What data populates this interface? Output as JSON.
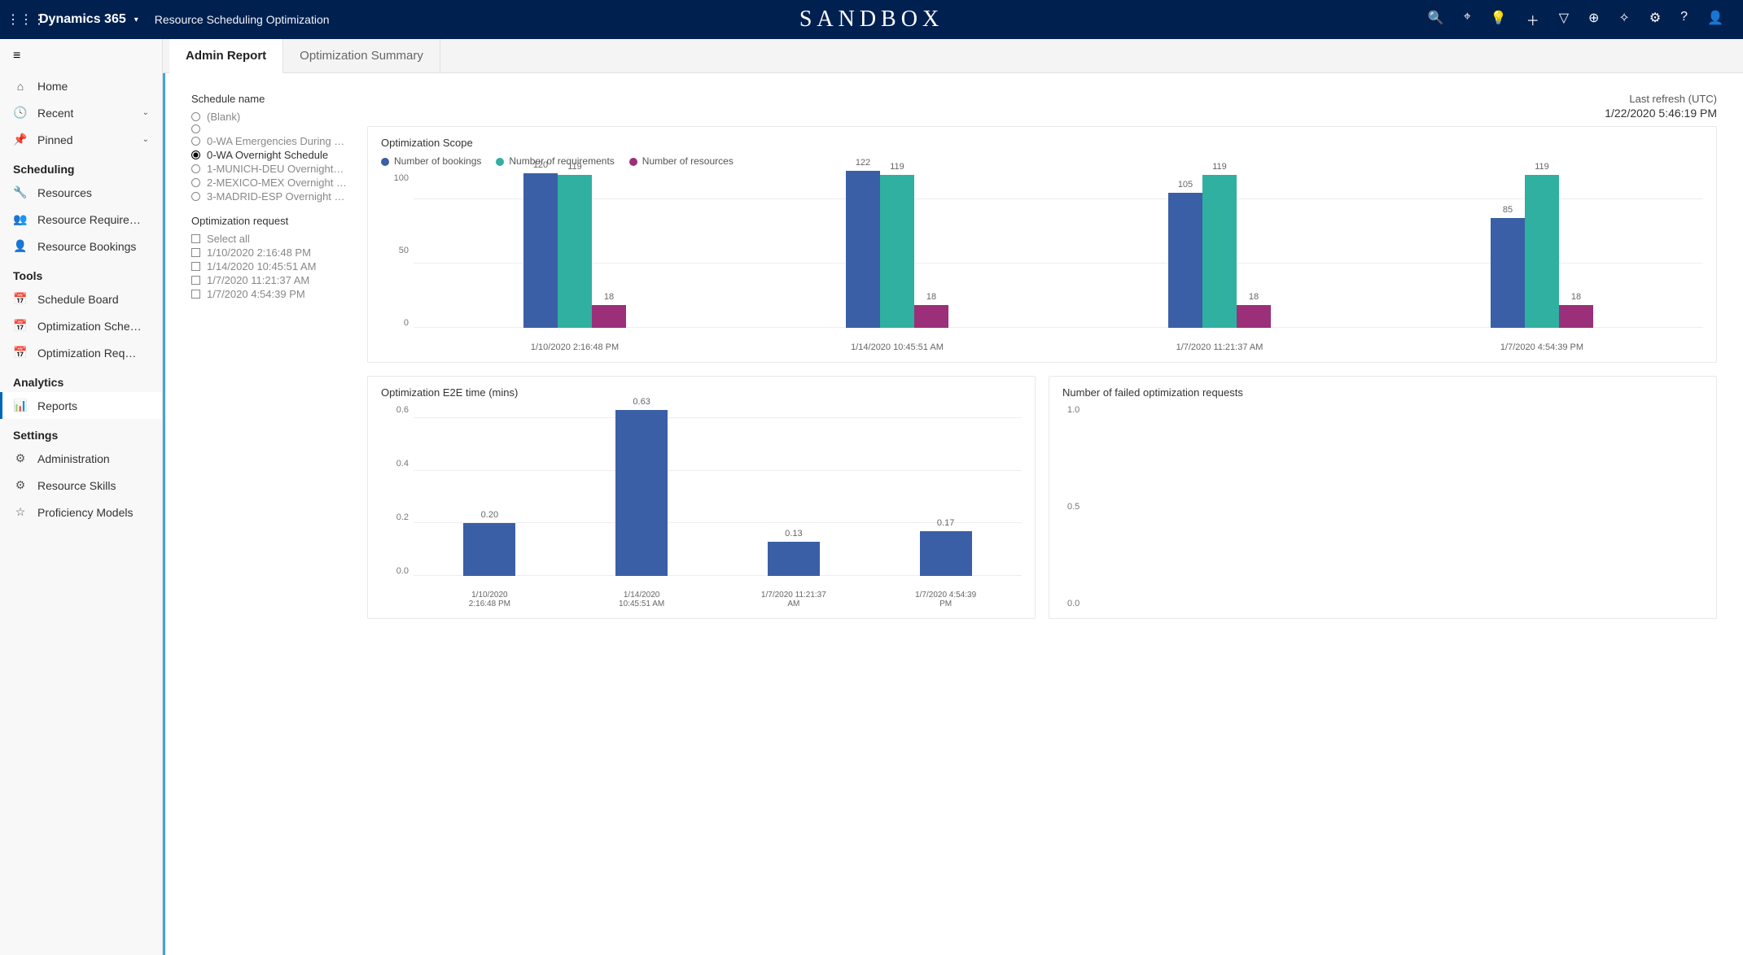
{
  "header": {
    "brand": "Dynamics 365",
    "subtitle": "Resource Scheduling Optimization",
    "envBadge": "SANDBOX"
  },
  "sidebar": {
    "top": [
      {
        "icon": "⌂",
        "label": "Home",
        "expandable": false
      },
      {
        "icon": "🕓",
        "label": "Recent",
        "expandable": true
      },
      {
        "icon": "📌",
        "label": "Pinned",
        "expandable": true
      }
    ],
    "groups": [
      {
        "title": "Scheduling",
        "items": [
          {
            "icon": "🔧",
            "label": "Resources"
          },
          {
            "icon": "👥",
            "label": "Resource Require…"
          },
          {
            "icon": "👤",
            "label": "Resource Bookings"
          }
        ]
      },
      {
        "title": "Tools",
        "items": [
          {
            "icon": "📅",
            "label": "Schedule Board"
          },
          {
            "icon": "📅",
            "label": "Optimization Sche…"
          },
          {
            "icon": "📅",
            "label": "Optimization Req…"
          }
        ]
      },
      {
        "title": "Analytics",
        "items": [
          {
            "icon": "📊",
            "label": "Reports",
            "active": true
          }
        ]
      },
      {
        "title": "Settings",
        "items": [
          {
            "icon": "⚙",
            "label": "Administration"
          },
          {
            "icon": "⚙",
            "label": "Resource Skills"
          },
          {
            "icon": "☆",
            "label": "Proficiency Models"
          }
        ]
      }
    ]
  },
  "tabs": [
    {
      "label": "Admin Report",
      "active": true
    },
    {
      "label": "Optimization Summary",
      "active": false
    }
  ],
  "refresh": {
    "label": "Last refresh (UTC)",
    "timestamp": "1/22/2020 5:46:19 PM"
  },
  "filters": {
    "schedule": {
      "title": "Schedule name",
      "options": [
        {
          "label": "(Blank)"
        },
        {
          "label": ""
        },
        {
          "label": "0-WA Emergencies During …"
        },
        {
          "label": "0-WA Overnight Schedule",
          "selected": true
        },
        {
          "label": "1-MUNICH-DEU Overnight…"
        },
        {
          "label": "2-MEXICO-MEX Overnight …"
        },
        {
          "label": "3-MADRID-ESP Overnight …"
        }
      ]
    },
    "request": {
      "title": "Optimization request",
      "options": [
        {
          "label": "Select all"
        },
        {
          "label": "1/10/2020 2:16:48 PM"
        },
        {
          "label": "1/14/2020 10:45:51 AM"
        },
        {
          "label": "1/7/2020 11:21:37 AM"
        },
        {
          "label": "1/7/2020 4:54:39 PM"
        }
      ]
    }
  },
  "chart_data": [
    {
      "type": "bar",
      "title": "Optimization Scope",
      "legend": [
        "Number of bookings",
        "Number of requirements",
        "Number of resources"
      ],
      "categories": [
        "1/10/2020 2:16:48 PM",
        "1/14/2020 10:45:51 AM",
        "1/7/2020 11:21:37 AM",
        "1/7/2020 4:54:39 PM"
      ],
      "series": [
        {
          "name": "Number of bookings",
          "values": [
            120,
            122,
            105,
            85
          ],
          "color": "#3b5fa6"
        },
        {
          "name": "Number of requirements",
          "values": [
            119,
            119,
            119,
            119
          ],
          "color": "#2fb0a0"
        },
        {
          "name": "Number of resources",
          "values": [
            18,
            18,
            18,
            18
          ],
          "color": "#9b2f7a"
        }
      ],
      "ymax": 120,
      "yticks": [
        0,
        50,
        100
      ]
    },
    {
      "type": "bar",
      "title": "Optimization E2E time (mins)",
      "categories": [
        "1/10/2020 2:16:48 PM",
        "1/14/2020 10:45:51 AM",
        "1/7/2020 11:21:37 AM",
        "1/7/2020 4:54:39 PM"
      ],
      "values": [
        0.2,
        0.63,
        0.13,
        0.17
      ],
      "ymax": 0.65,
      "yticks": [
        0.0,
        0.2,
        0.4,
        0.6
      ],
      "color": "#3b5fa6"
    },
    {
      "type": "bar",
      "title": "Number of failed optimization requests",
      "categories": [],
      "values": [],
      "ymax": 1.0,
      "yticks": [
        0.0,
        0.5,
        1.0
      ]
    }
  ]
}
